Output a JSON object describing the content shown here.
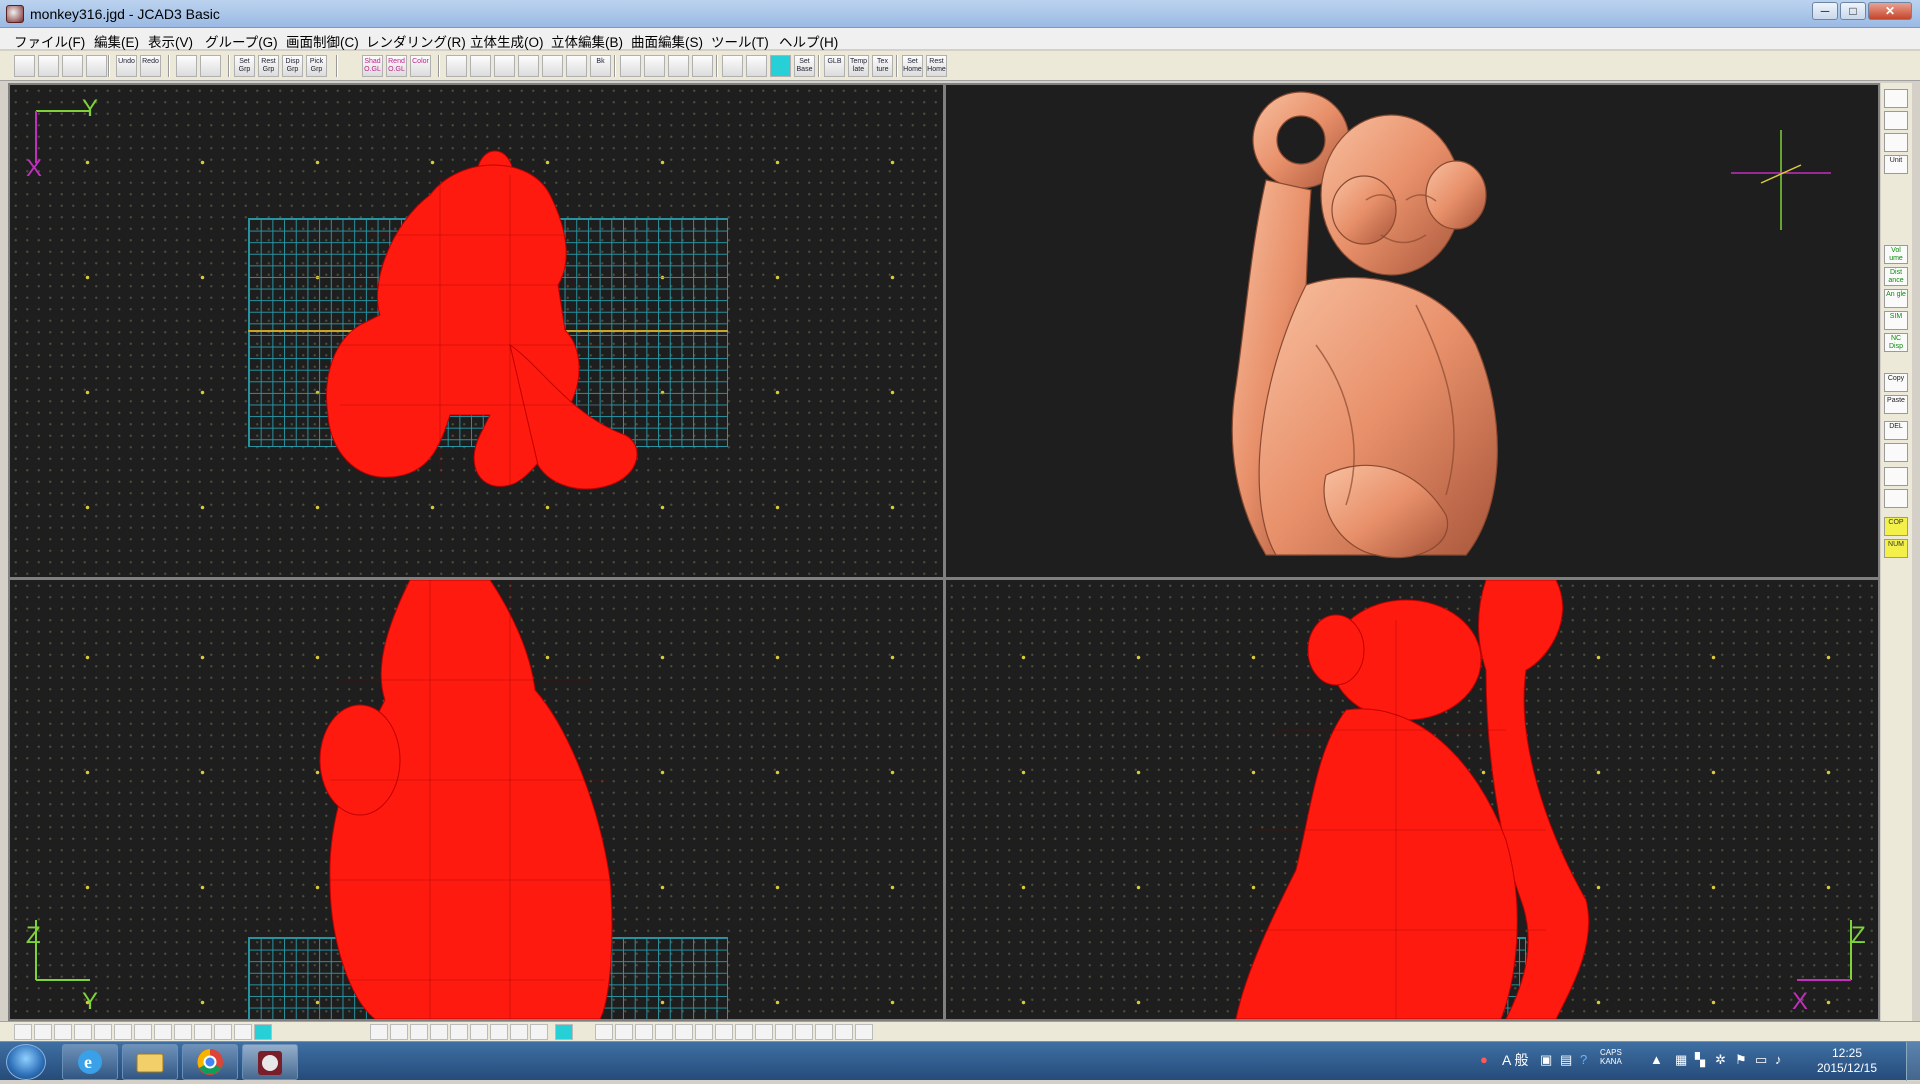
{
  "window": {
    "title": "monkey316.jgd - JCAD3 Basic",
    "minimize": "─",
    "maximize": "□",
    "close": "✕"
  },
  "menu": [
    "ファイル(F)",
    "編集(E)",
    "表示(V)",
    "グループ(G)",
    "画面制御(C)",
    "レンダリング(R)",
    "立体生成(O)",
    "立体編集(B)",
    "曲面編集(S)",
    "ツール(T)",
    "ヘルプ(H)"
  ],
  "toolbar": [
    {
      "label": "",
      "icon": "new-file-icon"
    },
    {
      "label": "",
      "icon": "open-folder-icon"
    },
    {
      "label": "",
      "icon": "save-icon"
    },
    {
      "label": "",
      "icon": "print-icon"
    },
    {
      "label": "Undo",
      "icon": "undo-icon"
    },
    {
      "label": "Redo",
      "icon": "redo-icon"
    },
    {
      "label": "",
      "icon": "group-icon"
    },
    {
      "label": "",
      "icon": "ungroup-icon"
    },
    {
      "label": "Set Grp",
      "icon": "set-group-icon"
    },
    {
      "label": "Rest Grp",
      "icon": "reset-group-icon"
    },
    {
      "label": "Disp Grp",
      "icon": "display-group-icon"
    },
    {
      "label": "Pick Grp",
      "icon": "pick-group-icon"
    },
    {
      "label": "Shad O.GL",
      "icon": "shade-opengl-icon"
    },
    {
      "label": "Rend O.GL",
      "icon": "render-opengl-icon"
    },
    {
      "label": "Color",
      "icon": "color-icon"
    },
    {
      "label": "",
      "icon": "zoom-in-icon"
    },
    {
      "label": "",
      "icon": "zoom-out-icon"
    },
    {
      "label": "",
      "icon": "zoom-fit-icon"
    },
    {
      "label": "",
      "icon": "zoom-window-icon"
    },
    {
      "label": "",
      "icon": "zoom-all-icon"
    },
    {
      "label": "",
      "icon": "pan-hand-icon"
    },
    {
      "label": "Bk",
      "icon": "back-view-icon"
    },
    {
      "label": "",
      "icon": "rotate-left-icon"
    },
    {
      "label": "",
      "icon": "rotate-right-icon"
    },
    {
      "label": "",
      "icon": "view-rotate-icon"
    },
    {
      "label": "",
      "icon": "view-reset-icon"
    },
    {
      "label": "",
      "icon": "grid-icon"
    },
    {
      "label": "",
      "icon": "snap-grid-icon"
    },
    {
      "label": "",
      "icon": "active-grid-icon"
    },
    {
      "label": "Set Base",
      "icon": "set-base-icon"
    },
    {
      "label": "GLB",
      "icon": "global-icon"
    },
    {
      "label": "Temp late",
      "icon": "template-icon"
    },
    {
      "label": "Tex ture",
      "icon": "texture-icon"
    },
    {
      "label": "Set Home",
      "icon": "set-home-icon"
    },
    {
      "label": "Rest Home",
      "icon": "reset-home-icon"
    }
  ],
  "viewports": [
    {
      "name": "top",
      "axis_h": "Y",
      "axis_v": "X"
    },
    {
      "name": "perspective",
      "axis_h": "",
      "axis_v": ""
    },
    {
      "name": "front",
      "axis_h": "Y",
      "axis_v": "Z"
    },
    {
      "name": "side",
      "axis_h": "X",
      "axis_v": "Z"
    }
  ],
  "right_bar": [
    {
      "label": "",
      "icon": "view-eye-icon"
    },
    {
      "label": "",
      "icon": "printer-3d-icon"
    },
    {
      "label": "",
      "icon": "layers-icon"
    },
    {
      "label": "Unit",
      "icon": "unit-icon"
    },
    {
      "label": "Vol ume",
      "icon": "volume-icon"
    },
    {
      "label": "Dist ance",
      "icon": "distance-icon"
    },
    {
      "label": "An gle",
      "icon": "angle-icon"
    },
    {
      "label": "SIM",
      "icon": "sim-icon"
    },
    {
      "label": "NC Disp",
      "icon": "nc-display-icon"
    },
    {
      "label": "Copy",
      "icon": "copy-icon"
    },
    {
      "label": "Paste",
      "icon": "paste-icon"
    },
    {
      "label": "DEL",
      "icon": "delete-icon"
    },
    {
      "label": "",
      "icon": "window-icon"
    },
    {
      "label": "",
      "icon": "tools-icon"
    },
    {
      "label": "",
      "icon": "tree-icon"
    },
    {
      "label": "COP",
      "icon": "cop-icon"
    },
    {
      "label": "NUM",
      "icon": "num-icon"
    }
  ],
  "taskbar": {
    "apps": [
      "internet-explorer-icon",
      "file-explorer-icon",
      "chrome-icon",
      "jcad3-icon"
    ],
    "ime": "A 般",
    "caps": "CAPS",
    "kana": "KANA",
    "time": "12:25",
    "date": "2015/12/15"
  },
  "colors": {
    "wire": "#ff1a0f",
    "grid": "#2aa9b8",
    "render": "#e8906a",
    "axis_green": "#7fd23a",
    "axis_magenta": "#c12fbd",
    "axis_yellow": "#d9cc3a"
  }
}
